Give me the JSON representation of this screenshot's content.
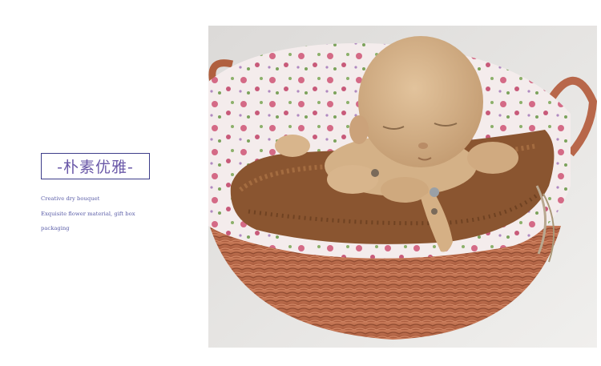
{
  "title": "-朴素优雅-",
  "description_lines": [
    "Creative dry bouquet",
    "Exquisite flower material, gift box",
    "packaging"
  ],
  "photo": {
    "icon": "doll-in-wicker-basket-photo",
    "colors": {
      "background": "#e7e6e4",
      "wicker": "#b9694a",
      "lining": "#f3eaea",
      "fleece": "#8a5530",
      "doll": "#d8b58c"
    }
  }
}
